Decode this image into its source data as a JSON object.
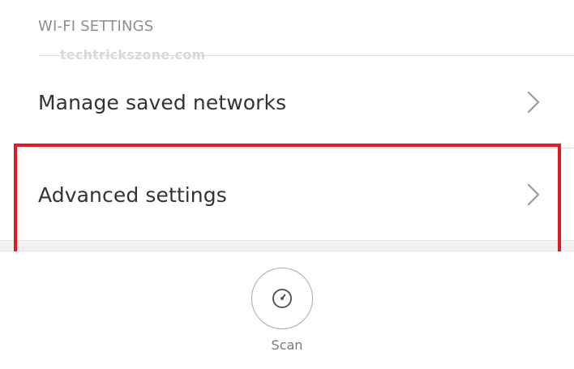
{
  "section": {
    "title": "WI-FI SETTINGS",
    "watermark": "techtrickszone.com"
  },
  "rows": [
    {
      "label": "Manage saved networks",
      "icon": "chevron-right-icon"
    },
    {
      "label": "Advanced settings",
      "icon": "chevron-right-icon"
    }
  ],
  "scan": {
    "label": "Scan",
    "icon": "gauge-icon"
  },
  "colors": {
    "highlight": "#e11b22",
    "header_text": "#8f8f8f",
    "row_text": "#333333",
    "chevron": "#9a9a9a",
    "scan_text": "#7a7a7a"
  }
}
